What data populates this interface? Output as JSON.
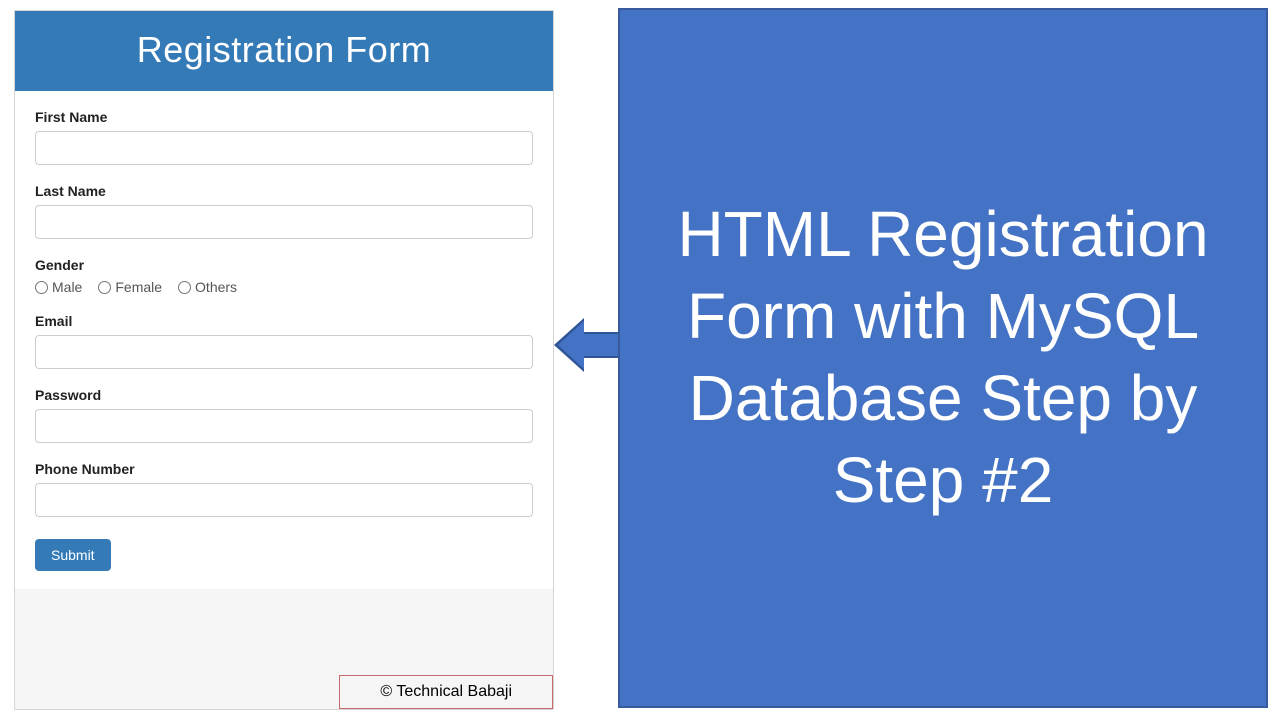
{
  "form": {
    "title": "Registration Form",
    "fields": {
      "first_name": {
        "label": "First Name",
        "value": ""
      },
      "last_name": {
        "label": "Last Name",
        "value": ""
      },
      "gender": {
        "label": "Gender",
        "options": [
          "Male",
          "Female",
          "Others"
        ]
      },
      "email": {
        "label": "Email",
        "value": ""
      },
      "password": {
        "label": "Password",
        "value": ""
      },
      "phone": {
        "label": "Phone Number",
        "value": ""
      }
    },
    "submit_label": "Submit",
    "footer": "© Technical Babaji"
  },
  "right_panel": {
    "text": "HTML Registration Form with MySQL Database Step by Step #2"
  }
}
